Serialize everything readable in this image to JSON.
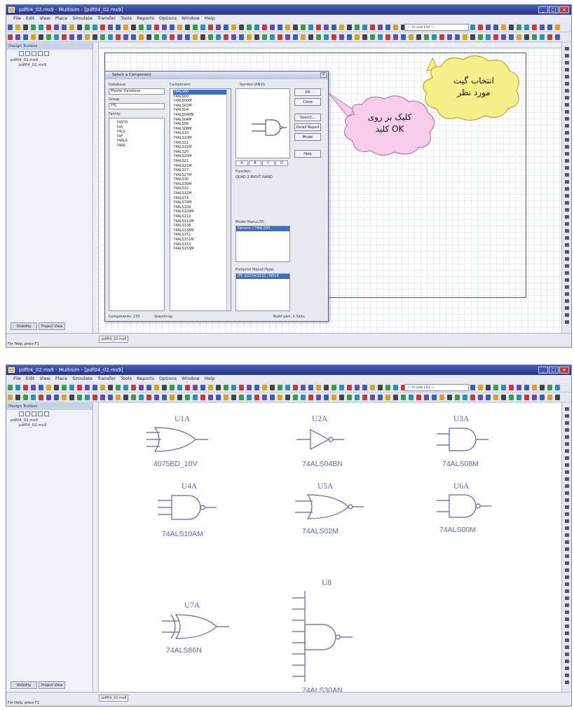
{
  "screen1": {
    "title": "pdf04_02.ms9 - Multisim - [pdf04_02.ms9]",
    "design_toolbox_title": "Design Toolbox",
    "tree_root": "pdf04_02.ms9",
    "tree_child": "pdf04_02.ms9",
    "side_tab_1": "Visibility",
    "side_tab_2": "Project View",
    "doc_tab": "pdf04_02.ms9",
    "status_left": "For Help, press F1",
    "in_use_combo": "--- In use List ---",
    "dialog": {
      "title": "Select a Component",
      "database_label": "Database:",
      "database_value": "Master Database",
      "group_label": "Group:",
      "group_value": "TTL",
      "family_label": "Family:",
      "family_items": [
        "74STD",
        "74S",
        "74LS",
        "74F",
        "74ALS",
        "74AS"
      ],
      "component_label": "Component:",
      "component_selected": "74ALS00",
      "component_items": [
        "74ALS00",
        "74ALS00M",
        "74ALS02M",
        "74ALS04",
        "74ALS04BN",
        "74ALS04M",
        "74ALS08",
        "74ALS08M",
        "74ALS10",
        "74ALS10M",
        "74ALS11",
        "74ALS11M",
        "74ALS20",
        "74ALS20M",
        "74ALS21",
        "74ALS21M",
        "74ALS27",
        "74ALS27M",
        "74ALS30",
        "74ALS30M",
        "74ALS32",
        "74ALS32M",
        "74ALS74",
        "74ALS74M",
        "74ALS109",
        "74ALS109M",
        "74ALS112",
        "74ALS112M",
        "74ALS138",
        "74ALS138M",
        "74ALS151",
        "74ALS151M",
        "74ALS153",
        "74ALS153M"
      ],
      "symbol_label": "Symbol (ANSI)",
      "symbol_tabs": [
        "A",
        "B",
        "C",
        "D"
      ],
      "function_label": "Function:",
      "function_value": "QUAD 2-INPUT NAND",
      "model_manuf_label": "Model Manuf./ID:",
      "model_manuf_value": "Generic / 74ALS00",
      "footprint_label": "Footprint Manuf./Type:",
      "footprint_value": "IPC-2221A/2222 / N014",
      "btn_ok": "OK",
      "btn_close": "Close",
      "btn_search": "Search...",
      "btn_detail": "Detail Report",
      "btn_model": "Model",
      "btn_help": "Help",
      "status_components": "Components: 235",
      "status_searching": "Searching:",
      "status_build": "Build part: 0 Slots"
    },
    "callout_gate": [
      "انتخاب گیت",
      "مورد نظر"
    ],
    "callout_ok": [
      "کلیک بر روی",
      "کلید OK"
    ]
  },
  "screen2": {
    "title": "pdf04_02.ms9 - Multisim - [pdf04_02.ms9]",
    "design_toolbox_title": "Design Toolbox",
    "tree_root": "pdf04_02.ms9",
    "tree_child": "pdf04_02.ms9",
    "side_tab_1": "Visibility",
    "side_tab_2": "Project View",
    "doc_tab": "pdf04_02.ms9",
    "status_left": "For Help, press F1",
    "in_use_combo": "--- In use List ---",
    "gates": [
      {
        "ref": "U1A",
        "part": "4075BD_10V"
      },
      {
        "ref": "U2A",
        "part": "74ALS04BN"
      },
      {
        "ref": "U3A",
        "part": "74ALS08M"
      },
      {
        "ref": "U4A",
        "part": "74ALS10AM"
      },
      {
        "ref": "U5A",
        "part": "74ALS02M"
      },
      {
        "ref": "U6A",
        "part": "74ALS00M"
      },
      {
        "ref": "U7A",
        "part": "74ALS86N"
      },
      {
        "ref": "U8",
        "part": "74ALS30AN"
      }
    ]
  },
  "menu_items": [
    "File",
    "Edit",
    "View",
    "Place",
    "Simulate",
    "Transfer",
    "Tools",
    "Reports",
    "Options",
    "Window",
    "Help"
  ],
  "colors": {
    "title_bar": "#24338c",
    "gate_stroke": "#5b66a8",
    "callout_fill": "#f6f08a",
    "callout_ok_fill": "#f7cdeb",
    "selection": "#3b6cc6"
  }
}
